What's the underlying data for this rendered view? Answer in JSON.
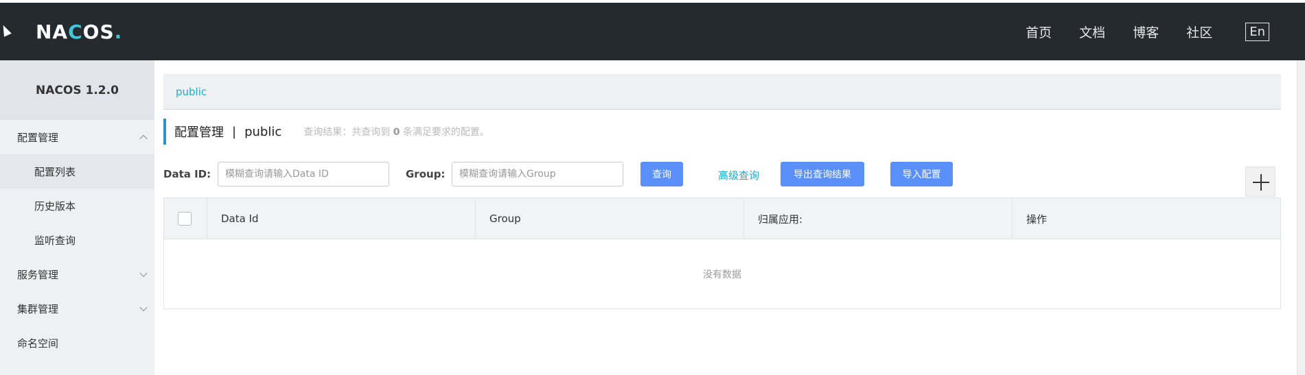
{
  "header": {
    "logo_main": "NA",
    "logo_accent": "C",
    "logo_end": "OS",
    "logo_dot": ".",
    "nav": [
      "首页",
      "文档",
      "博客",
      "社区"
    ],
    "lang": "En"
  },
  "sidebar": {
    "title": "NACOS 1.2.0",
    "items": [
      {
        "label": "配置管理"
      },
      {
        "label": "配置列表"
      },
      {
        "label": "历史版本"
      },
      {
        "label": "监听查询"
      },
      {
        "label": "服务管理"
      },
      {
        "label": "集群管理"
      },
      {
        "label": "命名空间"
      }
    ]
  },
  "main": {
    "breadcrumb": "public",
    "title": "配置管理",
    "separator": "|",
    "namespace": "public",
    "hint_prefix": "查询结果：共查询到",
    "hint_count": "0",
    "hint_suffix": "条满足要求的配置。",
    "search": {
      "data_id_label": "Data ID:",
      "data_id_placeholder": "模糊查询请输入Data ID",
      "group_label": "Group:",
      "group_placeholder": "模糊查询请输入Group",
      "query_button": "查询",
      "advanced_link": "高级查询",
      "export_button": "导出查询结果",
      "import_button": "导入配置"
    },
    "table": {
      "columns": [
        "Data Id",
        "Group",
        "归属应用:",
        "操作"
      ],
      "empty_text": "没有数据"
    }
  },
  "colors": {
    "header_bg": "#252a2f",
    "accent": "#1eaacf",
    "primary_button": "#5b8ff9"
  }
}
